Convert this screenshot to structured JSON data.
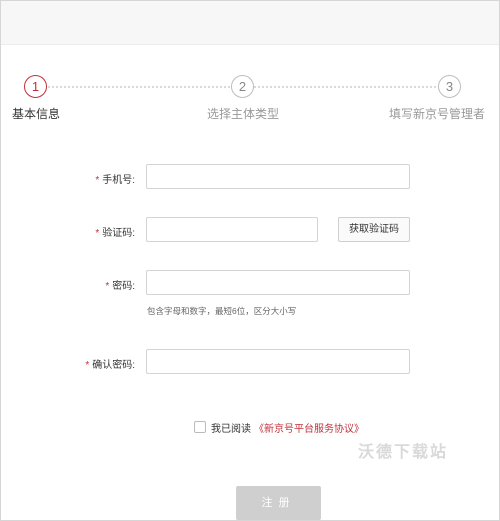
{
  "steps": [
    {
      "number": "1",
      "label": "基本信息",
      "active": true
    },
    {
      "number": "2",
      "label": "选择主体类型",
      "active": false
    },
    {
      "number": "3",
      "label": "填写新京号管理者",
      "active": false
    }
  ],
  "form": {
    "phone": {
      "required_mark": "*",
      "label": "手机号:",
      "value": "",
      "placeholder": ""
    },
    "verify_code": {
      "required_mark": "*",
      "label": "验证码:",
      "value": "",
      "placeholder": "",
      "button_label": "获取验证码"
    },
    "password": {
      "required_mark": "*",
      "label": "密码:",
      "value": "",
      "placeholder": "",
      "hint": "包含字母和数字，最短6位，区分大小写"
    },
    "confirm_password": {
      "required_mark": "*",
      "label": "确认密码:",
      "value": "",
      "placeholder": ""
    }
  },
  "agreement": {
    "checked": false,
    "text": "我已阅读",
    "link_text": "《新京号平台服务协议》"
  },
  "watermark": "沃德下载站",
  "submit_label": "注册",
  "colors": {
    "accent": "#c0313b",
    "disabled_button": "#cfcfcf"
  }
}
